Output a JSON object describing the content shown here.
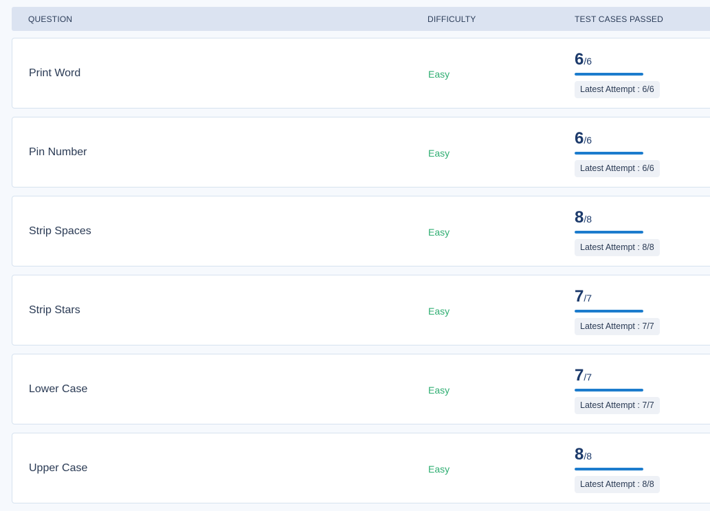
{
  "header": {
    "question": "QUESTION",
    "difficulty": "DIFFICULTY",
    "test_cases": "TEST CASES PASSED"
  },
  "questions": [
    {
      "title": "Print Word",
      "difficulty": "Easy",
      "passed": "6",
      "total": "/6",
      "progress": 1.0,
      "attempt": "Latest Attempt : 6/6"
    },
    {
      "title": "Pin Number",
      "difficulty": "Easy",
      "passed": "6",
      "total": "/6",
      "progress": 1.0,
      "attempt": "Latest Attempt : 6/6"
    },
    {
      "title": "Strip Spaces",
      "difficulty": "Easy",
      "passed": "8",
      "total": "/8",
      "progress": 1.0,
      "attempt": "Latest Attempt : 8/8"
    },
    {
      "title": "Strip Stars",
      "difficulty": "Easy",
      "passed": "7",
      "total": "/7",
      "progress": 1.0,
      "attempt": "Latest Attempt : 7/7"
    },
    {
      "title": "Lower Case",
      "difficulty": "Easy",
      "passed": "7",
      "total": "/7",
      "progress": 1.0,
      "attempt": "Latest Attempt : 7/7"
    },
    {
      "title": "Upper Case",
      "difficulty": "Easy",
      "passed": "8",
      "total": "/8",
      "progress": 1.0,
      "attempt": "Latest Attempt : 8/8"
    }
  ],
  "colors": {
    "difficulty_easy": "#2fae72",
    "progress": "#1c7ccd",
    "header_bg": "#dbe3f1"
  }
}
